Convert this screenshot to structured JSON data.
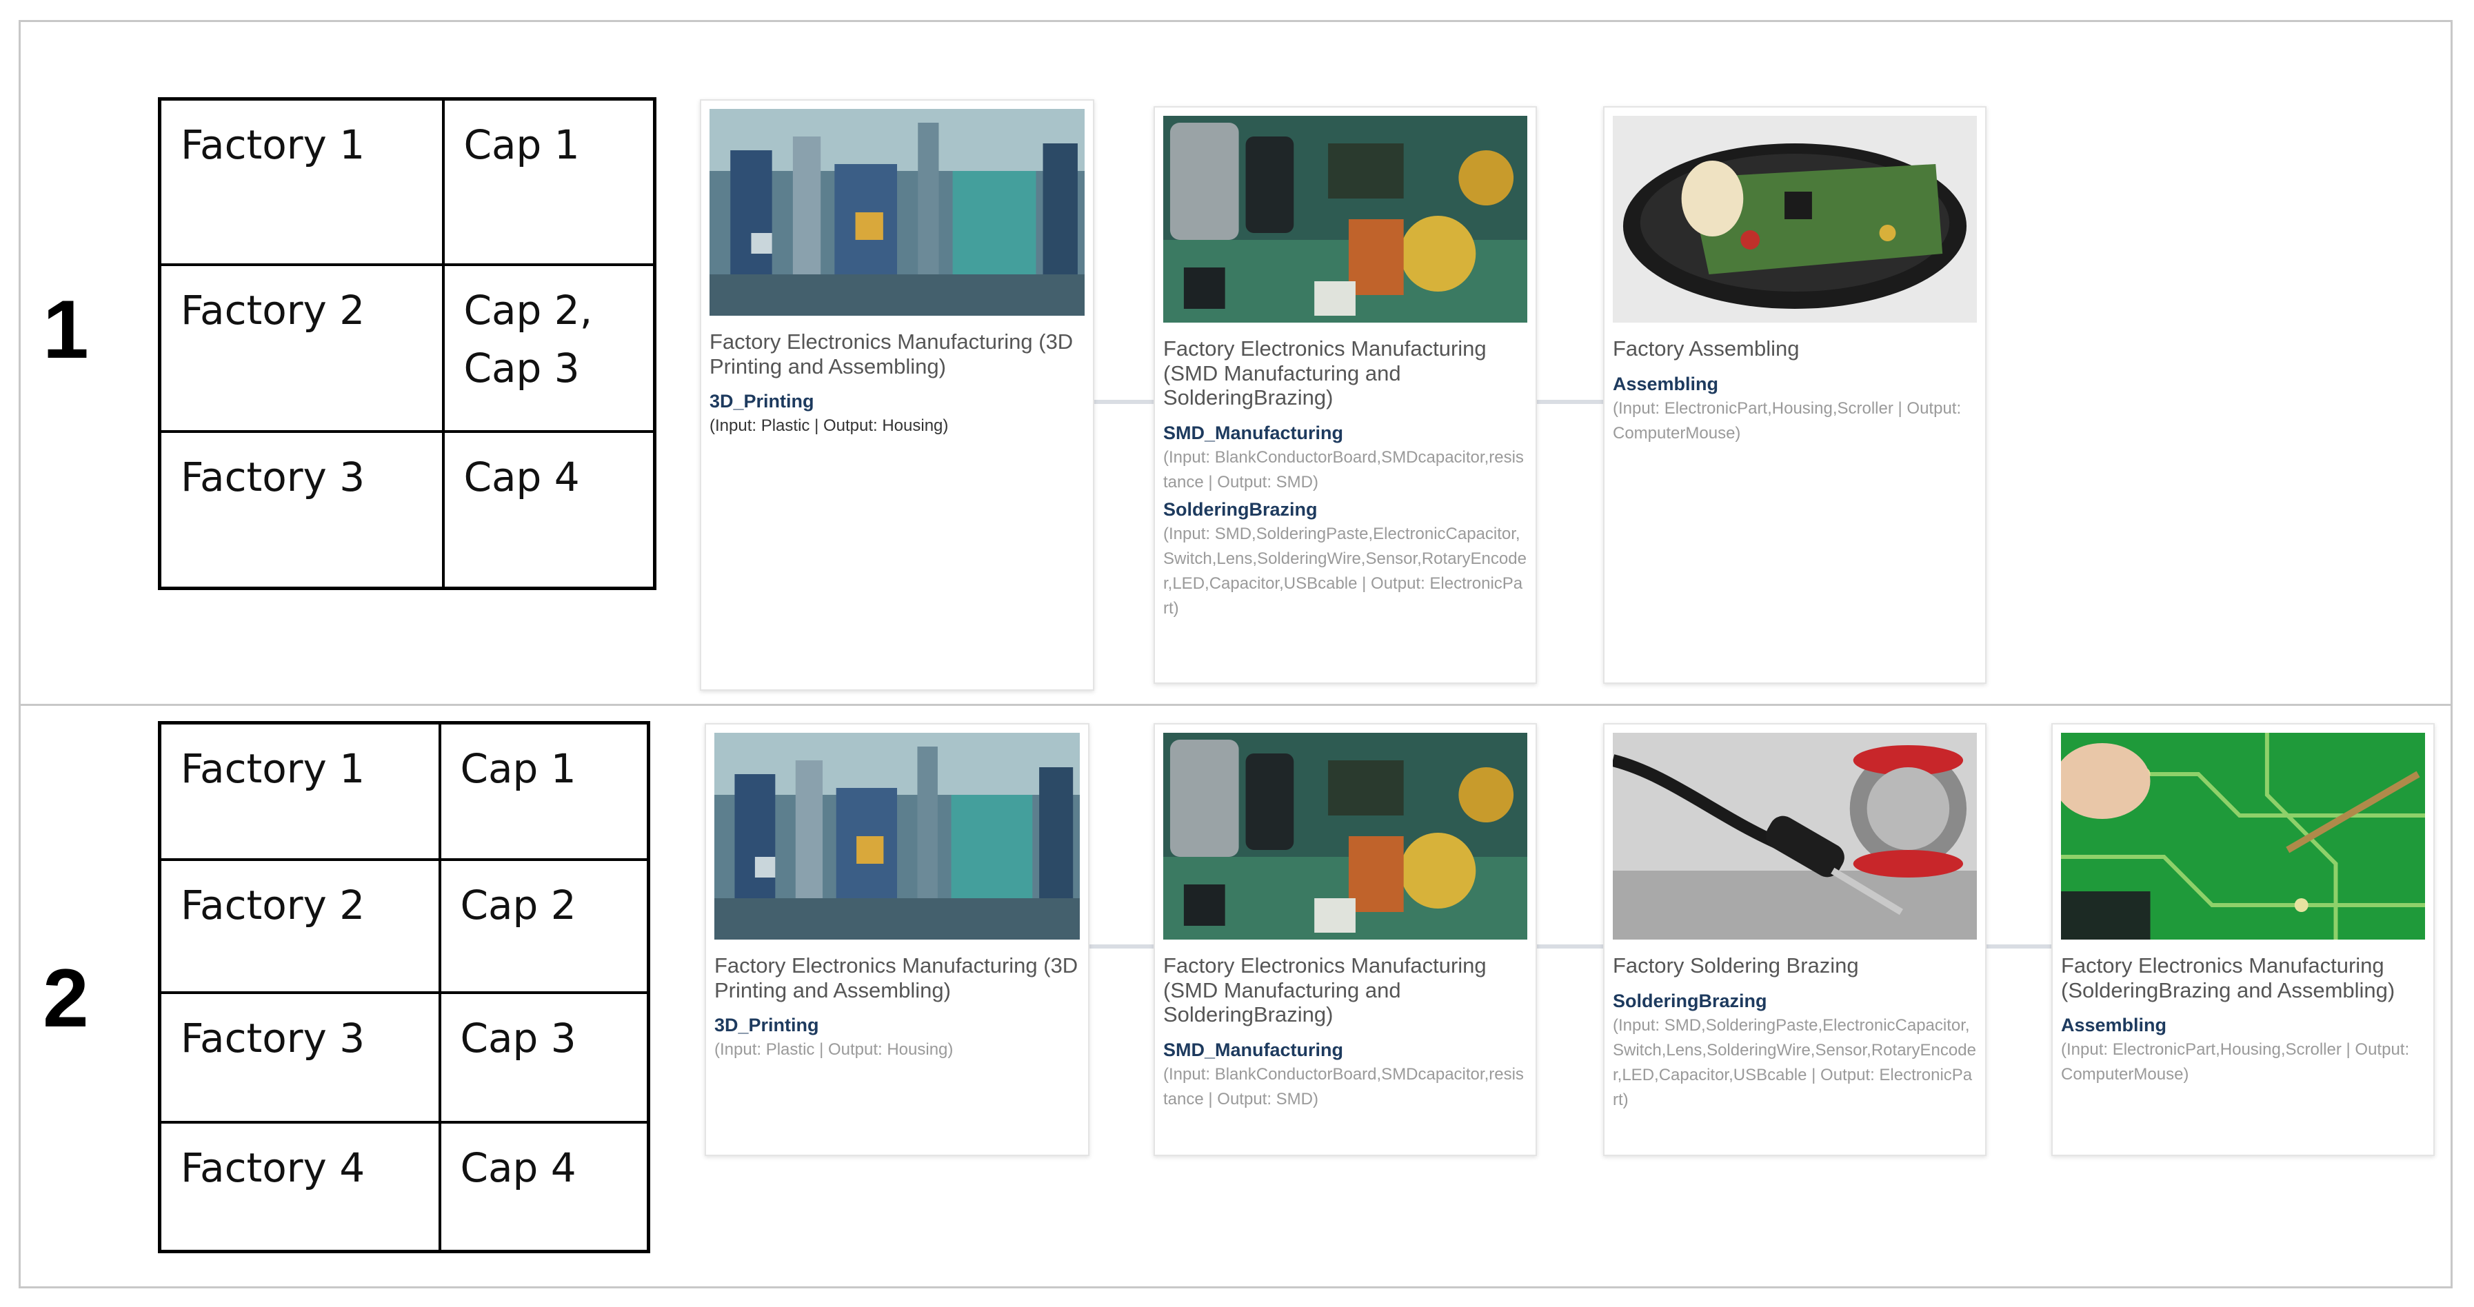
{
  "sections": [
    {
      "number": "1",
      "table": [
        {
          "factory": "Factory 1",
          "cap": "Cap 1"
        },
        {
          "factory": "Factory 2",
          "cap": "Cap 2,\nCap 3"
        },
        {
          "factory": "Factory 3",
          "cap": "Cap 4"
        }
      ],
      "cards": [
        {
          "image": "automated-factory-line",
          "title": "Factory Electronics Manufacturing (3D Printing and Assembling)",
          "caps": [
            {
              "name": "3D_Printing",
              "io": "(Input: Plastic | Output: Housing)"
            }
          ]
        },
        {
          "image": "circuit-board-capacitors",
          "title": "Factory Electronics Manufacturing (SMD Manufacturing and SolderingBrazing)",
          "caps": [
            {
              "name": "SMD_Manufacturing",
              "io": "(Input: BlankConductorBoard,SMDcapacitor,resistance | Output: SMD)"
            },
            {
              "name": "SolderingBrazing",
              "io": "(Input: SMD,SolderingPaste,ElectronicCapacitor,Switch,Lens,SolderingWire,Sensor,RotaryEncoder,LED,Capacitor,USBcable | Output: ElectronicPart)"
            }
          ]
        },
        {
          "image": "open-computer-mouse",
          "title": "Factory Assembling",
          "caps": [
            {
              "name": "Assembling",
              "io": "(Input: ElectronicPart,Housing,Scroller | Output: ComputerMouse)"
            }
          ]
        }
      ]
    },
    {
      "number": "2",
      "table": [
        {
          "factory": "Factory 1",
          "cap": "Cap 1"
        },
        {
          "factory": "Factory 2",
          "cap": "Cap 2"
        },
        {
          "factory": "Factory 3",
          "cap": "Cap 3"
        },
        {
          "factory": "Factory 4",
          "cap": "Cap 4"
        }
      ],
      "cards": [
        {
          "image": "automated-factory-line",
          "title": "Factory Electronics Manufacturing (3D Printing and Assembling)",
          "caps": [
            {
              "name": "3D_Printing",
              "io": "(Input: Plastic | Output: Housing)"
            }
          ]
        },
        {
          "image": "circuit-board-capacitors",
          "title": "Factory Electronics Manufacturing (SMD Manufacturing and SolderingBrazing)",
          "caps": [
            {
              "name": "SMD_Manufacturing",
              "io": "(Input: BlankConductorBoard,SMDcapacitor,resistance | Output: SMD)"
            }
          ]
        },
        {
          "image": "soldering-iron-and-wire",
          "title": "Factory Soldering Brazing",
          "caps": [
            {
              "name": "SolderingBrazing",
              "io": "(Input: SMD,SolderingPaste,ElectronicCapacitor,Switch,Lens,SolderingWire,Sensor,RotaryEncoder,LED,Capacitor,USBcable | Output: ElectronicPart)"
            }
          ]
        },
        {
          "image": "soldering-green-pcb",
          "title": "Factory Electronics Manufacturing (SolderingBrazing and Assembling)",
          "caps": [
            {
              "name": "Assembling",
              "io": "(Input: ElectronicPart,Housing,Scroller | Output: ComputerMouse)"
            }
          ]
        }
      ]
    }
  ]
}
